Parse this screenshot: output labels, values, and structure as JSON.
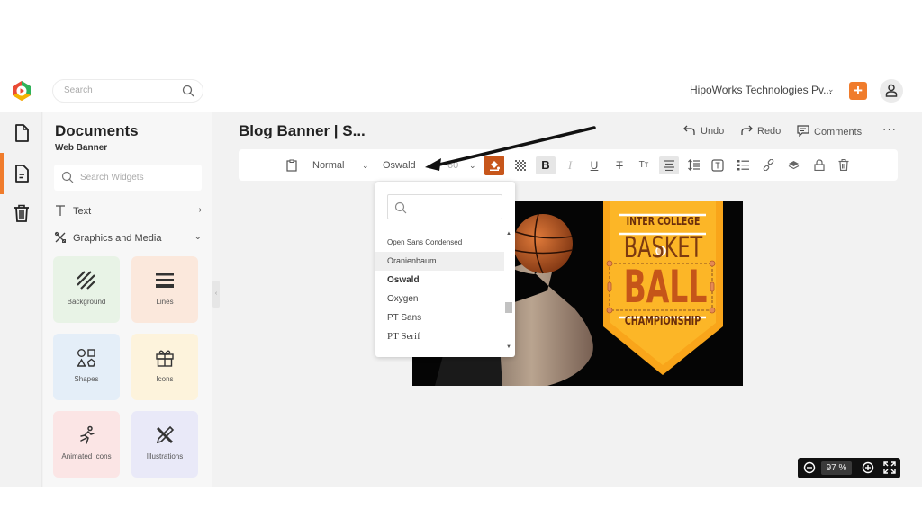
{
  "topbar": {
    "search_placeholder": "Search",
    "organization": "HipoWorks Technologies Pv...",
    "organization_chevron": "⌄",
    "add_button": "+"
  },
  "rail": {
    "items": [
      {
        "name": "documents",
        "icon": "document-icon"
      },
      {
        "name": "templates",
        "icon": "document-text-icon",
        "active": true
      },
      {
        "name": "trash",
        "icon": "trash-icon"
      }
    ],
    "accent_color": "#f07c2c"
  },
  "panel": {
    "title": "Documents",
    "subtitle": "Web Banner",
    "search_placeholder": "Search Widgets",
    "sections": [
      {
        "label": "Text",
        "chevron": "›",
        "icon": "text-icon"
      },
      {
        "label": "Graphics and Media",
        "chevron": "⌄",
        "icon": "graphics-icon"
      }
    ],
    "tiles": [
      {
        "label": "Background",
        "icon": "hatch-icon",
        "bg": "#e8f3e6"
      },
      {
        "label": "Lines",
        "icon": "lines-icon",
        "bg": "#fbe8dc"
      },
      {
        "label": "Shapes",
        "icon": "shapes-icon",
        "bg": "#e4eef8"
      },
      {
        "label": "Icons",
        "icon": "gift-icon",
        "bg": "#fdf3dc"
      },
      {
        "label": "Animated Icons",
        "icon": "running-icon",
        "bg": "#fbe5e5"
      },
      {
        "label": "Illustrations",
        "icon": "pencil-ruler-icon",
        "bg": "#e9e9f8"
      }
    ]
  },
  "editor": {
    "doc_title": "Blog Banner | S...",
    "undo": "Undo",
    "redo": "Redo",
    "comments": "Comments",
    "more": "···"
  },
  "toolbar": {
    "paragraph_style": "Normal",
    "font_family": "Oswald",
    "font_size": "60",
    "bold": "B",
    "italic": "I",
    "underline": "U",
    "strikethrough": "T",
    "text_case": "Tт",
    "fill_color": "#c7561b"
  },
  "font_dropdown": {
    "search_value": "",
    "options": [
      "Open Sans Condensed",
      "Oranienbaum",
      "Oswald",
      "Oxygen",
      "PT Sans",
      "PT Serif"
    ],
    "hovered": "Oranienbaum",
    "selected": "Oswald",
    "scroll_arrow_up": "▲",
    "scroll_arrow_down": "▼"
  },
  "banner": {
    "line1": "INTER COLLEGE",
    "line2": "BASKET",
    "line3": "BALL",
    "line4": "CHAMPIONSHIP",
    "badge_color": "#f7a81b",
    "text_color": "#8a3a0e"
  },
  "zoom": {
    "value": "97",
    "unit": "%"
  }
}
